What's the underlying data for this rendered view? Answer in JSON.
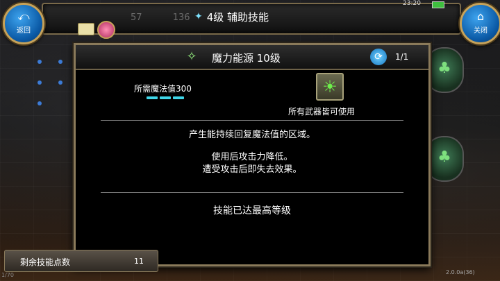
{
  "status_bar": {
    "time": "23:20"
  },
  "background": {
    "stat_a": "57",
    "stat_b": "136",
    "bottom_left": "1/70"
  },
  "header": {
    "star_glyph": "✦",
    "title": "4级 辅助技能",
    "back_label": "返回",
    "back_glyph": "⤺",
    "close_label": "关闭",
    "close_glyph": "⌂"
  },
  "skill_panel": {
    "icon_glyph": "✧",
    "skill_name": "魔力能源 10级",
    "refresh_glyph": "⟳",
    "page_counter": "1/1",
    "mp_requirement": "所需魔法值300",
    "mp_segments": 3,
    "weapon_glyph": "☀",
    "weapon_text": "所有武器皆可使用",
    "description_line1": "产生能持续回复魔法值的区域。",
    "description_line2": "使用后攻击力降低。",
    "description_line3": "遭受攻击后即失去效果。",
    "max_level_text": "技能已达最高等级"
  },
  "skill_points": {
    "label": "剩余技能点数",
    "value": "11"
  },
  "version": "2.0.0a(36)",
  "colors": {
    "accent_cyan": "#3fd6e8",
    "frame_gold": "#8a7a5a",
    "button_blue": "#0b5aa6"
  }
}
